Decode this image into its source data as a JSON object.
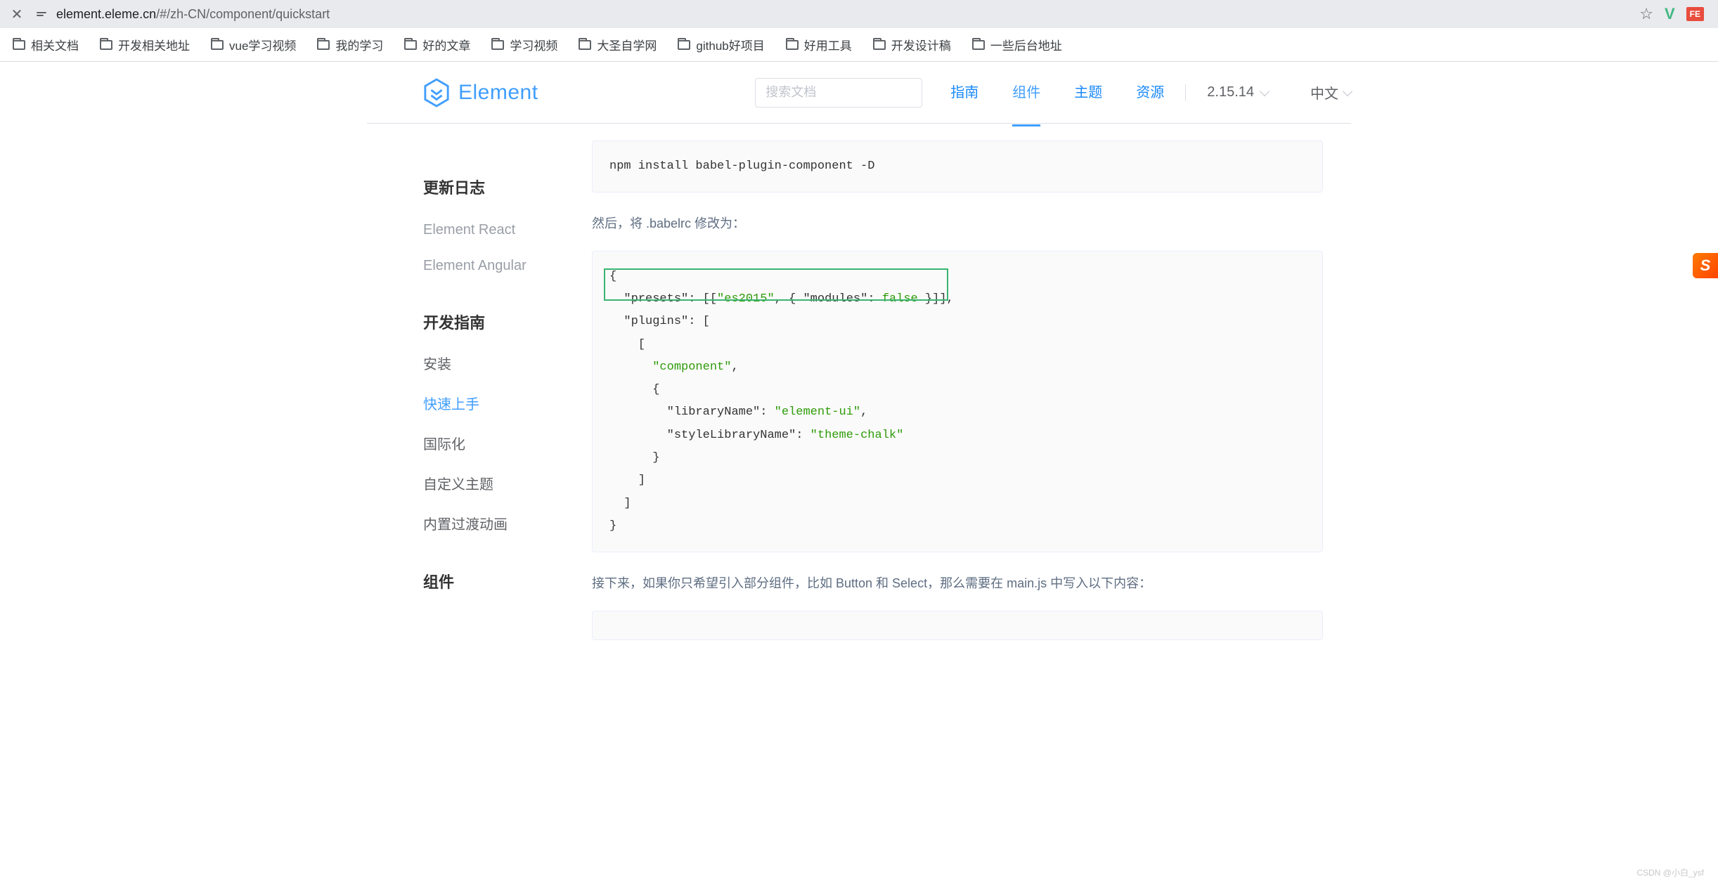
{
  "browser": {
    "url_host": "element.eleme.cn",
    "url_path": "/#/zh-CN/component/quickstart"
  },
  "bookmarks": [
    "相关文档",
    "开发相关地址",
    "vue学习视频",
    "我的学习",
    "好的文章",
    "学习视频",
    "大圣自学网",
    "github好项目",
    "好用工具",
    "开发设计稿",
    "一些后台地址"
  ],
  "header": {
    "logo": "Element",
    "search_placeholder": "搜索文档",
    "nav": [
      "指南",
      "组件",
      "主题",
      "资源"
    ],
    "nav_active_index": 1,
    "version": "2.15.14",
    "language": "中文"
  },
  "sidebar": {
    "top": [
      "更新日志",
      "Element React",
      "Element Angular"
    ],
    "section1_title": "开发指南",
    "section1_items": [
      "安装",
      "快速上手",
      "国际化",
      "自定义主题",
      "内置过渡动画"
    ],
    "section1_active": "快速上手",
    "section2_title": "组件"
  },
  "content": {
    "code1": "npm install babel-plugin-component -D",
    "para1": "然后，将 .babelrc 修改为：",
    "code2_lines": [
      "{",
      "  \"presets\": [[\"es2015\", { \"modules\": false }]],",
      "  \"plugins\": [",
      "    [",
      "      \"component\",",
      "      {",
      "        \"libraryName\": \"element-ui\",",
      "        \"styleLibraryName\": \"theme-chalk\"",
      "      }",
      "    ]",
      "  ]",
      "}"
    ],
    "para2": "接下来，如果你只希望引入部分组件，比如 Button 和 Select，那么需要在 main.js 中写入以下内容："
  },
  "watermark": "CSDN @小白_ysf",
  "float_badge": "S"
}
